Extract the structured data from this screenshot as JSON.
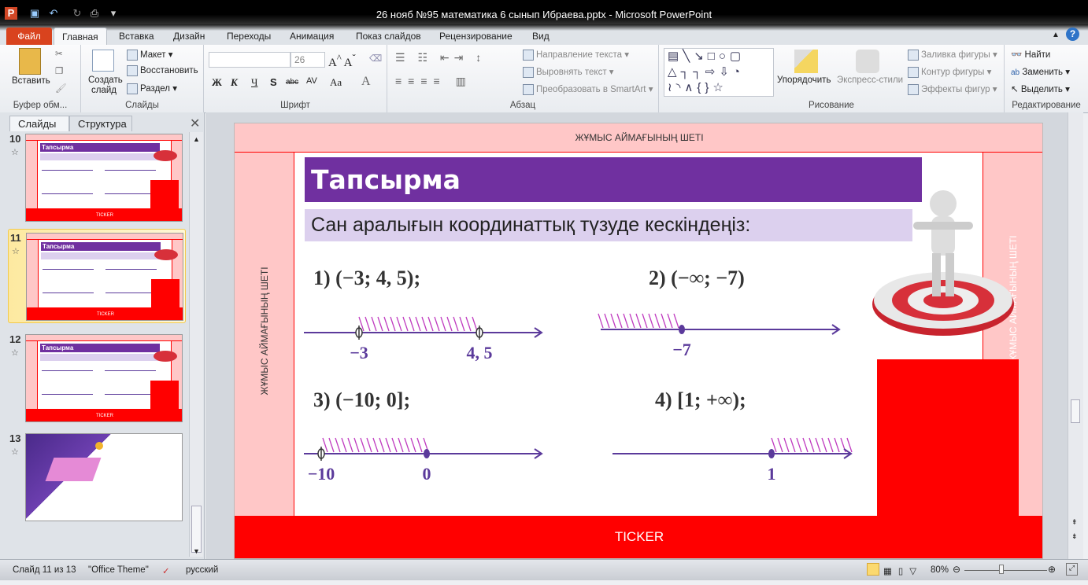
{
  "window": {
    "title": "26 нояб №95 математика 6 сынып Ибраева.pptx  -  Microsoft PowerPoint"
  },
  "tabs": [
    "Файл",
    "Главная",
    "Вставка",
    "Дизайн",
    "Переходы",
    "Анимация",
    "Показ слайдов",
    "Рецензирование",
    "Вид"
  ],
  "ribbon": {
    "clipboard": {
      "label": "Буфер обм...",
      "paste": "Вставить"
    },
    "slides": {
      "label": "Слайды",
      "new_slide": "Создать",
      "new_slide2": "слайд",
      "layout": "Макет",
      "reset": "Восстановить",
      "section": "Раздел"
    },
    "font": {
      "label": "Шрифт",
      "font_name": "",
      "font_size": "26",
      "bold": "Ж",
      "italic": "К",
      "underline": "Ч",
      "shadow": "S",
      "strike": "abc",
      "spacing": "AV",
      "case": "Aa",
      "color": "A"
    },
    "paragraph": {
      "label": "Абзац",
      "text_direction": "Направление текста",
      "align_text": "Выровнять текст",
      "smartart": "Преобразовать в SmartArt"
    },
    "drawing": {
      "label": "Рисование",
      "arrange": "Упорядочить",
      "quick_styles": "Экспресс-стили",
      "fill": "Заливка фигуры",
      "outline": "Контур фигуры",
      "effects": "Эффекты фигур"
    },
    "editing": {
      "label": "Редактирование",
      "find": "Найти",
      "replace": "Заменить",
      "select": "Выделить"
    }
  },
  "panel": {
    "tab_slides": "Слайды",
    "tab_outline": "Структура",
    "thumbs": [
      {
        "num": "10",
        "title": "Тапсырма",
        "ticker": "TICKER"
      },
      {
        "num": "11",
        "title": "Тапсырма",
        "ticker": "TICKER"
      },
      {
        "num": "12",
        "title": "Тапсырма",
        "ticker": "TICKER"
      },
      {
        "num": "13"
      }
    ]
  },
  "slide": {
    "top_band": "ЖҰМЫС АЙМАҒЫНЫҢ ШЕТІ",
    "left_band": "ЖҰМЫС АЙМАҒЫНЫҢ ШЕТІ",
    "right_band": "ЖҰМЫС АЙМАҒЫНЫҢ ШЕТІ",
    "title": "Тапсырма",
    "subtitle": "Сан аралығын координаттық түзуде кескіндеңіз:",
    "ticker": "TICKER",
    "problems": [
      {
        "label": "1) (−3; 4, 5);",
        "points": [
          {
            "t": "−3",
            "filled": false
          },
          {
            "t": "4, 5",
            "filled": false
          }
        ]
      },
      {
        "label": "2) (−∞; −7)",
        "points": [
          {
            "t": "−7",
            "filled": true
          }
        ]
      },
      {
        "label": "3) (−10; 0];",
        "points": [
          {
            "t": "−10",
            "filled": false
          },
          {
            "t": "0",
            "filled": true
          }
        ]
      },
      {
        "label": "4) [1; +∞);",
        "points": [
          {
            "t": "1",
            "filled": true
          }
        ]
      }
    ],
    "colors": {
      "purple": "#7030a0",
      "lavender": "#dcd0ee",
      "red": "#ff0000",
      "pink": "#ffc7c7",
      "line": "#5b3a9b",
      "hatch": "#c03cc0"
    }
  },
  "status": {
    "slide": "Слайд 11 из 13",
    "theme": "\"Office Theme\"",
    "lang": "русский",
    "zoom": "80%",
    "zoom_percent": 80
  }
}
